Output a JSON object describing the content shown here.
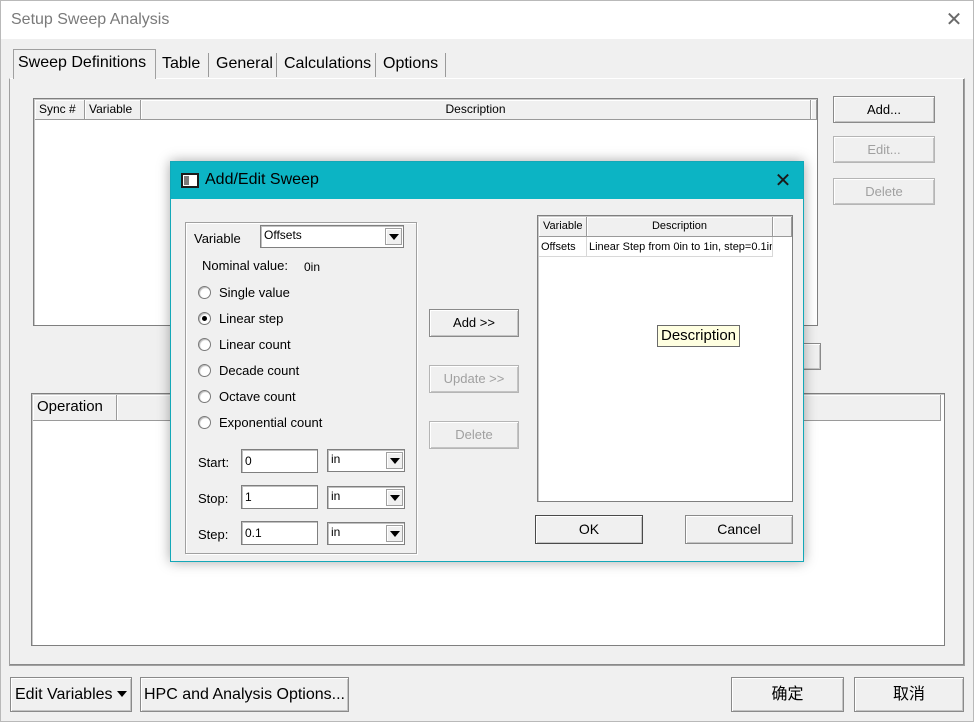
{
  "window": {
    "title": "Setup Sweep Analysis",
    "close_glyph": "✕"
  },
  "tabs": [
    "Sweep Definitions",
    "Table",
    "General",
    "Calculations",
    "Options"
  ],
  "sweep_grid": {
    "columns": [
      "Sync #",
      "Variable",
      "Description"
    ]
  },
  "side_buttons": {
    "add": "Add...",
    "edit": "Edit...",
    "delete": "Delete"
  },
  "operation_grid": {
    "columns": [
      "Operation"
    ]
  },
  "footer": {
    "edit_variables": "Edit Variables",
    "hpc_options": "HPC and Analysis Options...",
    "ok": "确定",
    "cancel": "取消"
  },
  "dialog": {
    "title": "Add/Edit Sweep",
    "close_glyph": "✕",
    "variable_label": "Variable",
    "variable_value": "Offsets",
    "nominal_label": "Nominal value:",
    "nominal_value": "0in",
    "sweep_types": [
      {
        "label": "Single value",
        "selected": false
      },
      {
        "label": "Linear step",
        "selected": true
      },
      {
        "label": "Linear count",
        "selected": false
      },
      {
        "label": "Decade count",
        "selected": false
      },
      {
        "label": "Octave count",
        "selected": false
      },
      {
        "label": "Exponential count",
        "selected": false
      }
    ],
    "start": {
      "label": "Start:",
      "value": "0",
      "unit": "in"
    },
    "stop": {
      "label": "Stop:",
      "value": "1",
      "unit": "in"
    },
    "step": {
      "label": "Step:",
      "value": "0.1",
      "unit": "in"
    },
    "add_button": "Add >>",
    "update_button": "Update >>",
    "delete_button": "Delete",
    "list_columns": [
      "Variable",
      "Description"
    ],
    "list_rows": [
      {
        "variable": "Offsets",
        "description": "Linear Step from 0in to 1in, step=0.1in"
      }
    ],
    "tooltip": "Description",
    "ok_button": "OK",
    "cancel_button": "Cancel"
  },
  "colors": {
    "dialog_title_bar": "#0cb4c4",
    "window_background": "#f0f0f0",
    "tooltip_background": "#ffffe1"
  }
}
